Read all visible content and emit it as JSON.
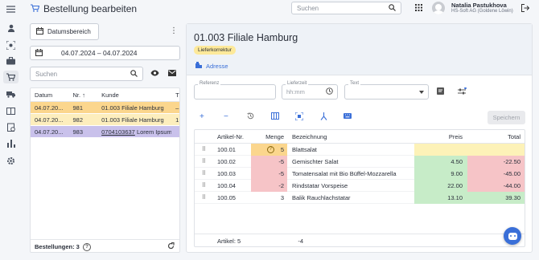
{
  "header": {
    "title": "Bestellung bearbeiten",
    "search_placeholder": "Suchen",
    "user_name": "Natalia Pastukhova",
    "user_org": "HS-Soft AG (Goldene Löwin)"
  },
  "left": {
    "range_button": "Datumsbereich",
    "date_range": "04.07.2024 – 04.07.2024",
    "search_placeholder": "Suchen",
    "columns": [
      "Datum",
      "Nr.",
      "Kunde",
      "T"
    ],
    "rows": [
      {
        "datum": "04.07.20...",
        "nr": "981",
        "kunde": "01.003 Filiale Hamburg",
        "t": "–",
        "status": "orange"
      },
      {
        "datum": "04.07.20...",
        "nr": "982",
        "kunde": "01.003 Filiale Hamburg",
        "t": "1",
        "status": "yellow"
      },
      {
        "datum": "04.07.20...",
        "nr": "983",
        "kunde_code": "0704103637",
        "kunde": "Lorem Ipsum",
        "t": "",
        "status": "purple"
      }
    ],
    "footer": "Bestellungen: 3"
  },
  "order": {
    "title": "01.003 Filiale Hamburg",
    "badge": "Lieferkorrektur",
    "address_link": "Adresse",
    "fields": {
      "referenz_label": "Referenz",
      "lieferzeit_label": "Lieferzeit",
      "lieferzeit_placeholder": "hh:mm",
      "text_label": "Text"
    },
    "save_label": "Speichern",
    "columns": {
      "art": "Artikel-Nr.",
      "menge": "Menge",
      "bez": "Bezeichnung",
      "preis": "Preis",
      "total": "Total"
    },
    "items": [
      {
        "art": "100.01",
        "menge": "5",
        "bez": "Blattsalat",
        "preis": "",
        "total": ""
      },
      {
        "art": "100.02",
        "menge": "-5",
        "bez": "Gemischter Salat",
        "preis": "4.50",
        "total": "-22.50"
      },
      {
        "art": "100.03",
        "menge": "-5",
        "bez": "Tomatensalat mit Bio Büffel-Mozzarella",
        "preis": "9.00",
        "total": "-45.00"
      },
      {
        "art": "100.04",
        "menge": "-2",
        "bez": "Rindstatar Vorspeise",
        "preis": "22.00",
        "total": "-44.00"
      },
      {
        "art": "100.05",
        "menge": "3",
        "bez": "Balik Rauchlachstatar",
        "preis": "13.10",
        "total": "39.30"
      }
    ],
    "footer_label": "Artikel: 5",
    "footer_sum": "-4"
  },
  "colors": {
    "accent": "#3a6fd8",
    "row_orange": "#fbd68d",
    "row_yellow": "#fdeebd",
    "row_purple": "#c9c1eb",
    "neg": "#f6c4c7",
    "pos": "#c7ecc8"
  }
}
